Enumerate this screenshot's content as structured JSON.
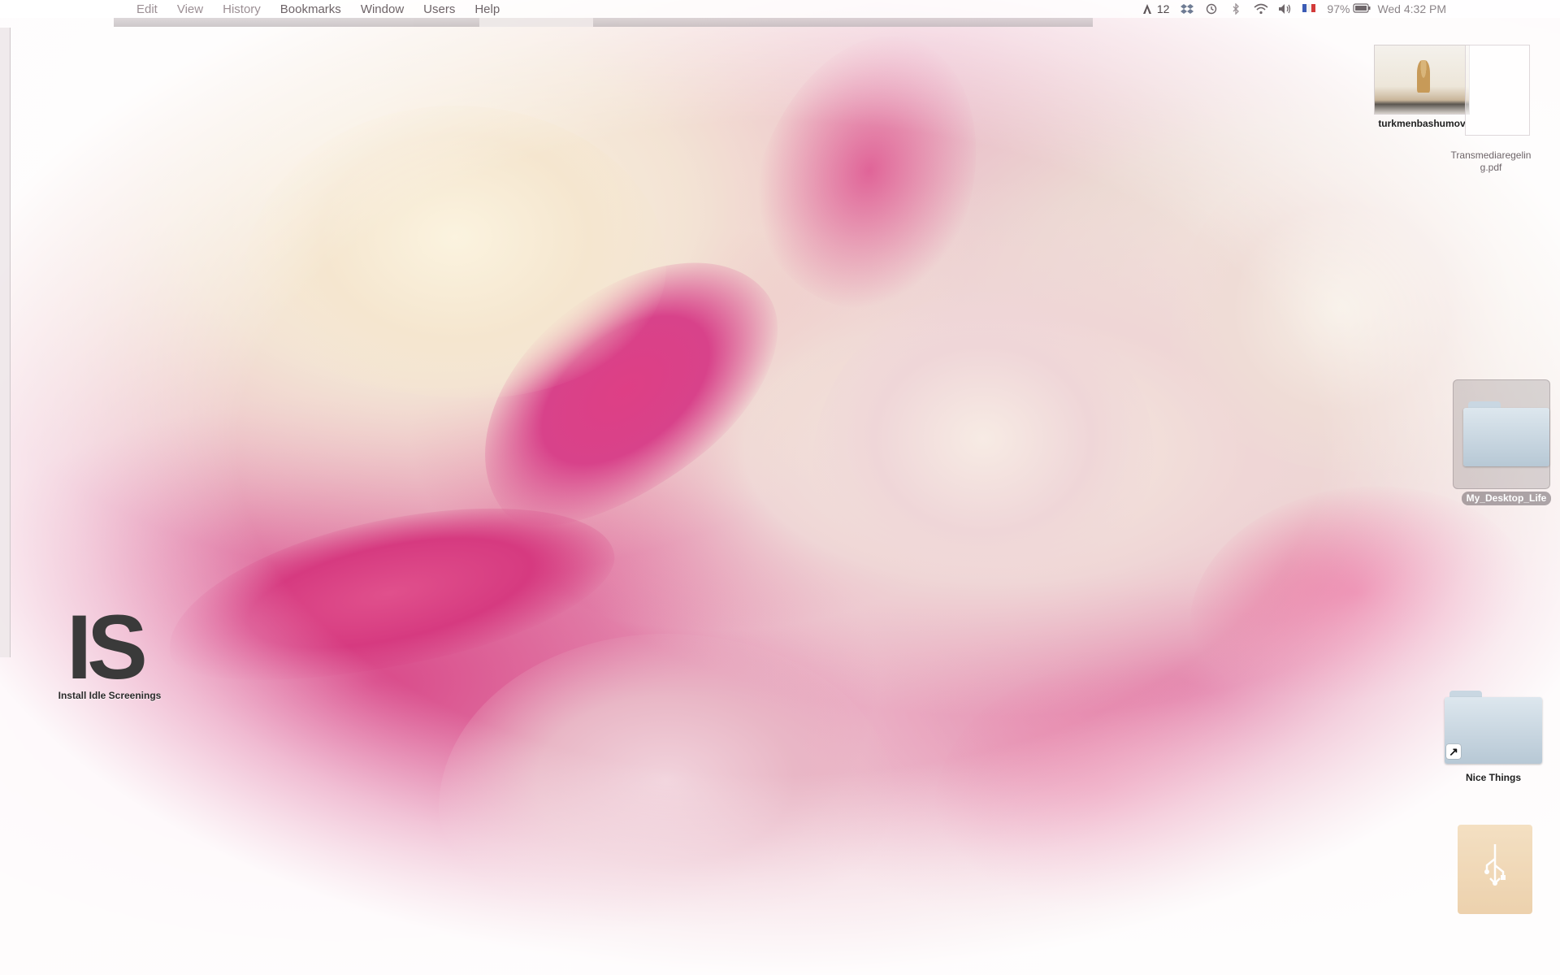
{
  "menubar": {
    "items": [
      "Edit",
      "View",
      "History",
      "Bookmarks",
      "Window",
      "Users",
      "Help"
    ],
    "status": {
      "adobe_count": "12",
      "battery": "97%",
      "clock": "Wed 4:32 PM"
    }
  },
  "desktop": {
    "icons": {
      "install": {
        "logo": "IS",
        "label": "Install Idle Screenings"
      },
      "turkmen": {
        "label": "turkmenbashumov"
      },
      "transmedia": {
        "label": "Transmediaregelin g.pdf"
      },
      "my_desktop": {
        "label": "My_Desktop_Life"
      },
      "nice_things": {
        "label": "Nice Things"
      }
    }
  },
  "colors": {
    "rose_pink": "#d9357e",
    "rose_cream": "#f6ecdf",
    "folder_blue": "#c9d7e2"
  }
}
